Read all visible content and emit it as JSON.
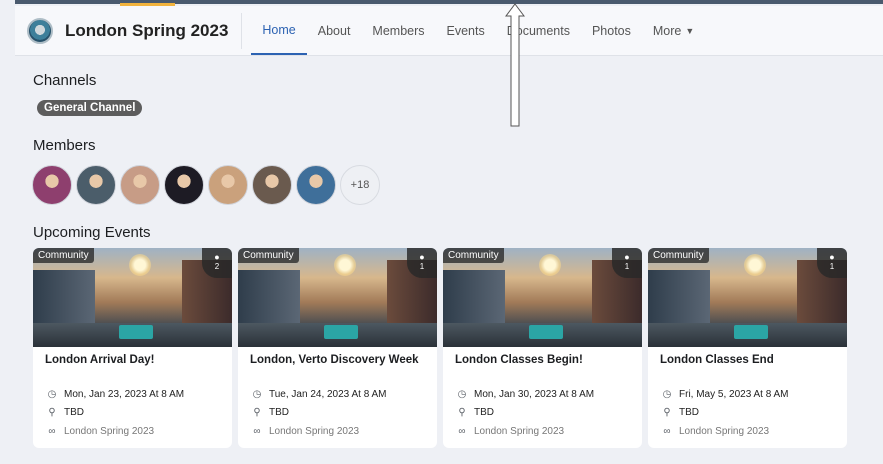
{
  "header": {
    "group_name": "London Spring 2023",
    "tabs": [
      {
        "label": "Home",
        "active": true
      },
      {
        "label": "About"
      },
      {
        "label": "Members"
      },
      {
        "label": "Events"
      },
      {
        "label": "Documents"
      },
      {
        "label": "Photos"
      },
      {
        "label": "More"
      }
    ]
  },
  "channels": {
    "title": "Channels",
    "items": [
      "General Channel"
    ]
  },
  "members": {
    "title": "Members",
    "more_count": "+18",
    "avatar_colors": [
      "#8e3f6e",
      "#4b5d6a",
      "#c79c86",
      "#1d1b24",
      "#caa17c",
      "#6a5a4e",
      "#3f6f9a"
    ]
  },
  "events": {
    "title": "Upcoming Events",
    "cards": [
      {
        "tag": "Community",
        "count": "2",
        "title": "London Arrival Day!",
        "datetime": "Mon, Jan 23, 2023 At 8 AM",
        "location": "TBD",
        "group": "London Spring 2023"
      },
      {
        "tag": "Community",
        "count": "1",
        "title": "London, Verto Discovery Week",
        "datetime": "Tue, Jan 24, 2023 At 8 AM",
        "location": "TBD",
        "group": "London Spring 2023"
      },
      {
        "tag": "Community",
        "count": "1",
        "title": "London Classes Begin!",
        "datetime": "Mon, Jan 30, 2023 At 8 AM",
        "location": "TBD",
        "group": "London Spring 2023"
      },
      {
        "tag": "Community",
        "count": "1",
        "title": "London Classes End",
        "datetime": "Fri, May 5, 2023 At 8 AM",
        "location": "TBD",
        "group": "London Spring 2023"
      }
    ]
  },
  "colors": {
    "accent": "#2c62b2",
    "badge": "#5d5d5d",
    "background": "#eef0f5"
  },
  "icons": {
    "clock": "clock-icon",
    "location": "map-pin-icon",
    "group": "group-icon",
    "attendees": "person-icon"
  }
}
